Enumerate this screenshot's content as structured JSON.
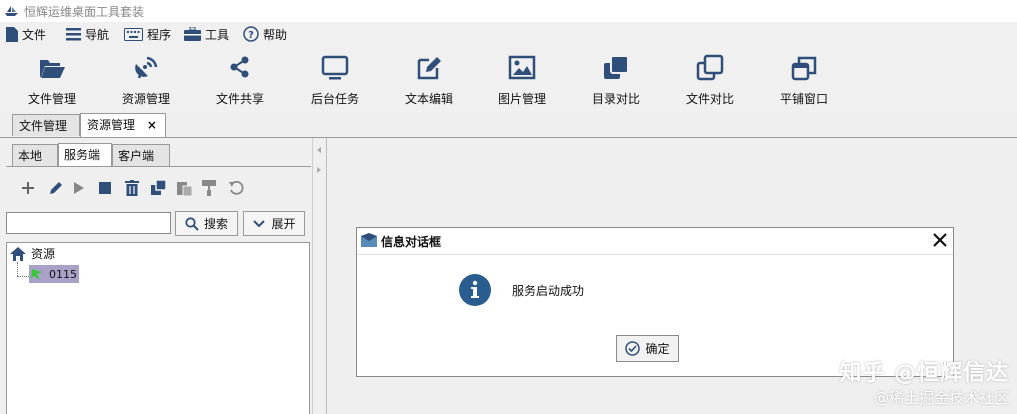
{
  "window": {
    "title": "恒辉运维桌面工具套装"
  },
  "menu": [
    {
      "label": "文件",
      "icon": "file-icon"
    },
    {
      "label": "导航",
      "icon": "list-icon"
    },
    {
      "label": "程序",
      "icon": "keyboard-icon"
    },
    {
      "label": "工具",
      "icon": "toolbox-icon"
    },
    {
      "label": "帮助",
      "icon": "help-icon"
    }
  ],
  "toolbar": [
    {
      "label": "文件管理",
      "icon": "folder-open-icon"
    },
    {
      "label": "资源管理",
      "icon": "satellite-icon"
    },
    {
      "label": "文件共享",
      "icon": "share-icon"
    },
    {
      "label": "后台任务",
      "icon": "monitor-icon"
    },
    {
      "label": "文本编辑",
      "icon": "edit-icon"
    },
    {
      "label": "图片管理",
      "icon": "image-icon"
    },
    {
      "label": "目录对比",
      "icon": "clone-icon"
    },
    {
      "label": "文件对比",
      "icon": "copy-icon"
    },
    {
      "label": "平铺窗口",
      "icon": "window-restore-icon"
    }
  ],
  "tabs": [
    {
      "label": "文件管理"
    },
    {
      "label": "资源管理",
      "close": "×"
    }
  ],
  "panel": {
    "tabs": [
      {
        "label": "本地"
      },
      {
        "label": "服务端"
      },
      {
        "label": "客户端"
      }
    ],
    "search": {
      "value": "",
      "placeholder": ""
    },
    "search_button": "搜索",
    "expand_button": "展开",
    "tree": {
      "root": "资源",
      "child": "0115"
    }
  },
  "dialog": {
    "title": "信息对话框",
    "message": "服务启动成功",
    "ok": "确定"
  },
  "watermark": {
    "line1": "知乎 @恒辉信达",
    "line2": "@稀土掘金技术社区"
  },
  "colors": {
    "accent": "#2f4f7a",
    "info": "#2a5d8f",
    "selection": "#a9a1c8",
    "leaf": "#3cc63c"
  }
}
